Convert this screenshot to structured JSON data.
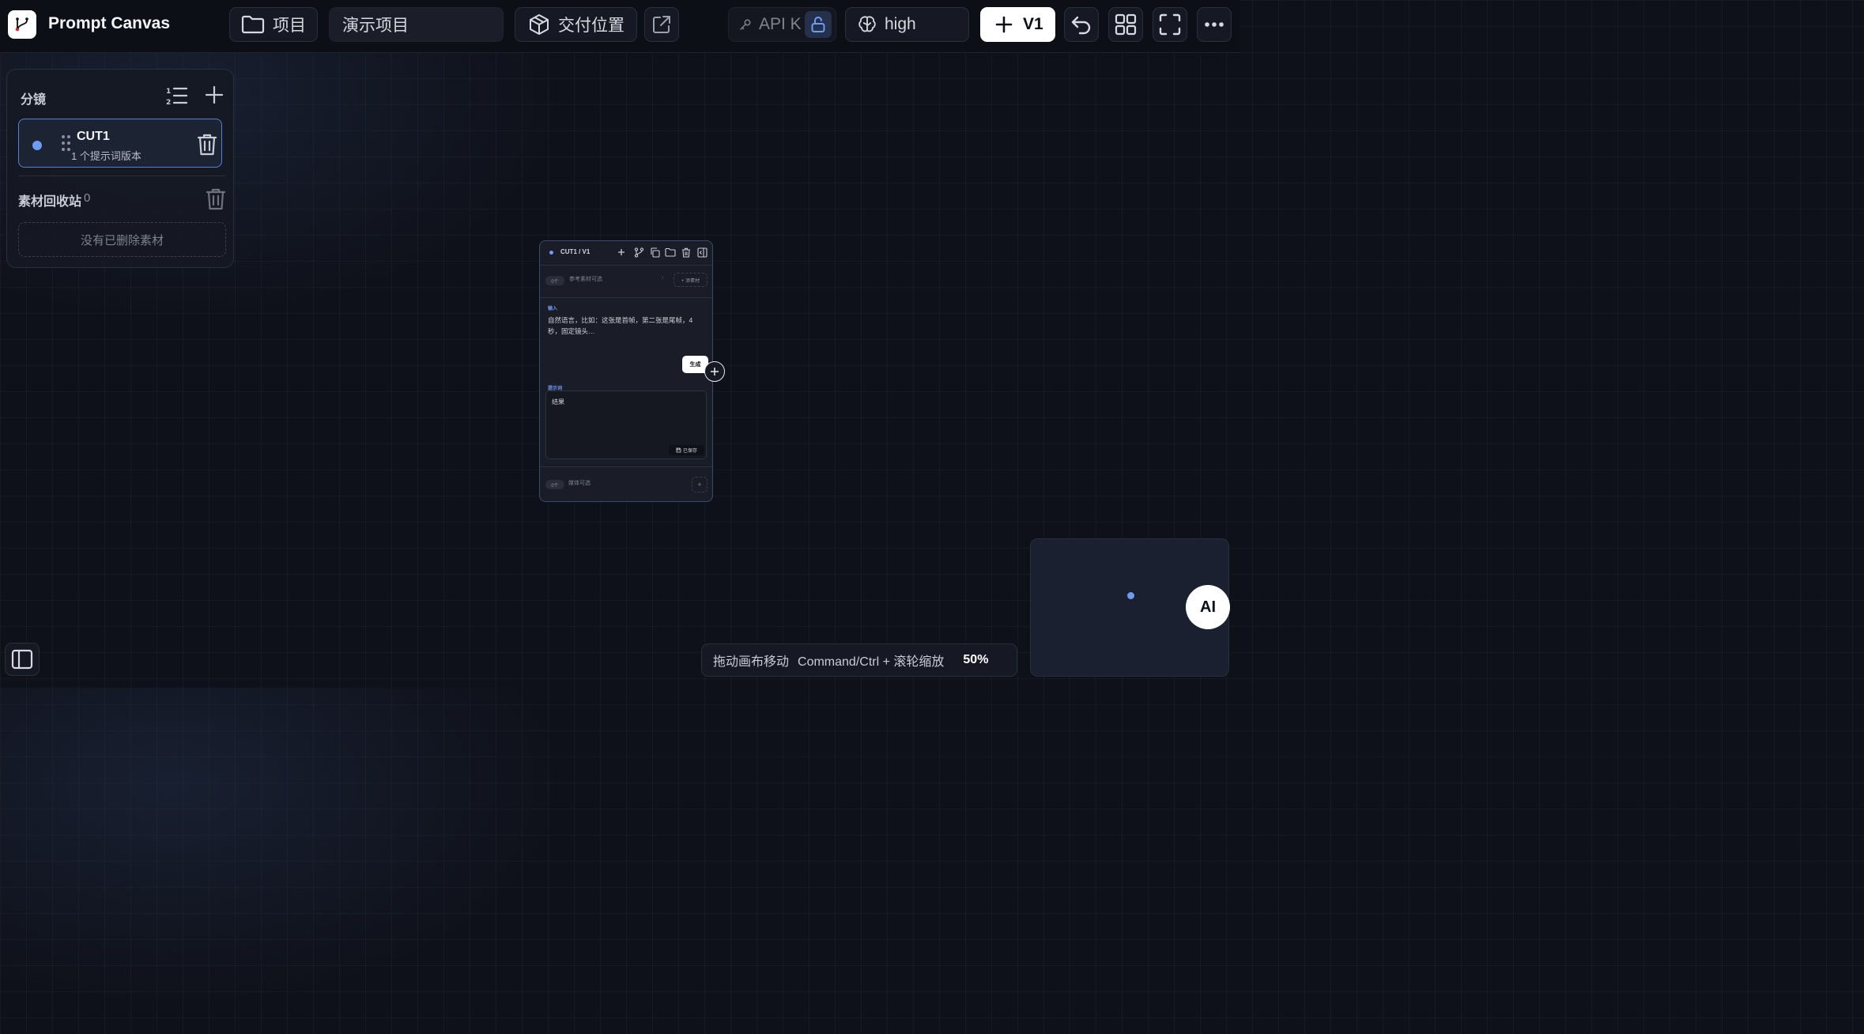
{
  "header": {
    "app_title": "Prompt Canvas",
    "project_button": "项目",
    "project_name": "演示项目",
    "delivery_button": "交付位置",
    "api_key_label": "API K",
    "model_effort": "high",
    "new_version_label": "V1"
  },
  "sidebar": {
    "shots_title": "分镜",
    "cut": {
      "name": "CUT1",
      "subtitle": "1 个提示词版本"
    },
    "recycle_title": "素材回收站",
    "recycle_count": "0",
    "recycle_empty": "没有已删除素材"
  },
  "node": {
    "title": "CUT1 / V1",
    "asset_count": "0个",
    "asset_hint": "参考素材可选",
    "add_asset": "+ 添素材",
    "input_label": "输入",
    "input_placeholder": "自然语言，比如：这张是首帧，第二张是尾帧，4秒，固定镜头…",
    "generate_button": "生成",
    "prompt_label": "提示词",
    "result_text": "结果",
    "saved_badge": "已保存",
    "media_count": "0个",
    "media_hint": "媒体可选"
  },
  "footer": {
    "hint_drag": "拖动画布移动",
    "hint_zoom": "Command/Ctrl + 滚轮缩放",
    "zoom_level": "50%",
    "ai_button": "AI"
  },
  "colors": {
    "accent": "#6f9bf5",
    "background": "#0f111a"
  }
}
